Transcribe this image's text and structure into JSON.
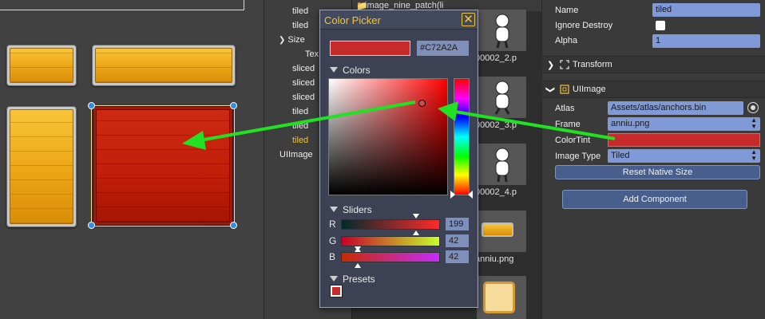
{
  "hierarchy": {
    "rows": [
      "tiled",
      "tiled",
      "Size",
      "Tex",
      "sliced",
      "sliced",
      "sliced",
      "tiled",
      "tiled",
      "tiled",
      "UIImage"
    ]
  },
  "assets": {
    "header": "image_nine_patch(li",
    "thumbs": [
      "00002_2.p",
      "00002_3.p",
      "00002_4.p",
      "anniu.png"
    ]
  },
  "picker": {
    "title": "Color Picker",
    "hex": "#C72A2A",
    "swatch_color": "#C72A2A",
    "colors_label": "Colors",
    "sliders_label": "Sliders",
    "presets_label": "Presets",
    "sliders": [
      {
        "label": "R",
        "value": "199"
      },
      {
        "label": "G",
        "value": "42"
      },
      {
        "label": "B",
        "value": "42"
      }
    ]
  },
  "inspector": {
    "name_label": "Name",
    "name_value": "tiled",
    "ignore_destroy_label": "Ignore Destroy",
    "ignore_destroy_checked": false,
    "alpha_label": "Alpha",
    "alpha_value": "1",
    "transform_title": "Transform",
    "uiimage_title": "UIImage",
    "atlas_label": "Atlas",
    "atlas_value": "Assets/atlas/anchors.bin",
    "frame_label": "Frame",
    "frame_value": "anniu.png",
    "colortint_label": "ColorTint",
    "colortint_value": "#C72A2A",
    "image_type_label": "Image Type",
    "image_type_value": "Tiled",
    "reset_button": "Reset Native Size",
    "add_component_button": "Add Component"
  },
  "colors": {
    "accent_yellow": "#F2C52E",
    "highlight_arrow": "#22E022"
  }
}
